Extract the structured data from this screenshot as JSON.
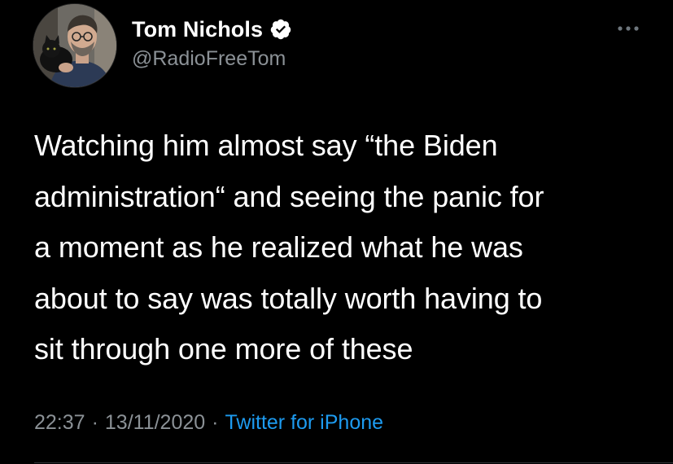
{
  "author": {
    "display_name": "Tom Nichols",
    "handle": "@RadioFreeTom",
    "verified": true,
    "avatar_icon": "profile-photo-man-with-cat"
  },
  "tweet": {
    "text": "Watching him almost say “the Biden\nadministration“ and seeing the  panic for\na moment as he realized what he was\nabout to say was totally worth having to\nsit through one more of these"
  },
  "meta": {
    "time": "22:37",
    "separator": "·",
    "date": "13/11/2020",
    "source": "Twitter for iPhone"
  },
  "icons": {
    "verified": "verified-badge-icon",
    "more": "more-options-icon"
  },
  "colors": {
    "background": "#000000",
    "text_primary": "#ffffff",
    "text_secondary": "#8b9196",
    "link": "#1d9bf0"
  }
}
